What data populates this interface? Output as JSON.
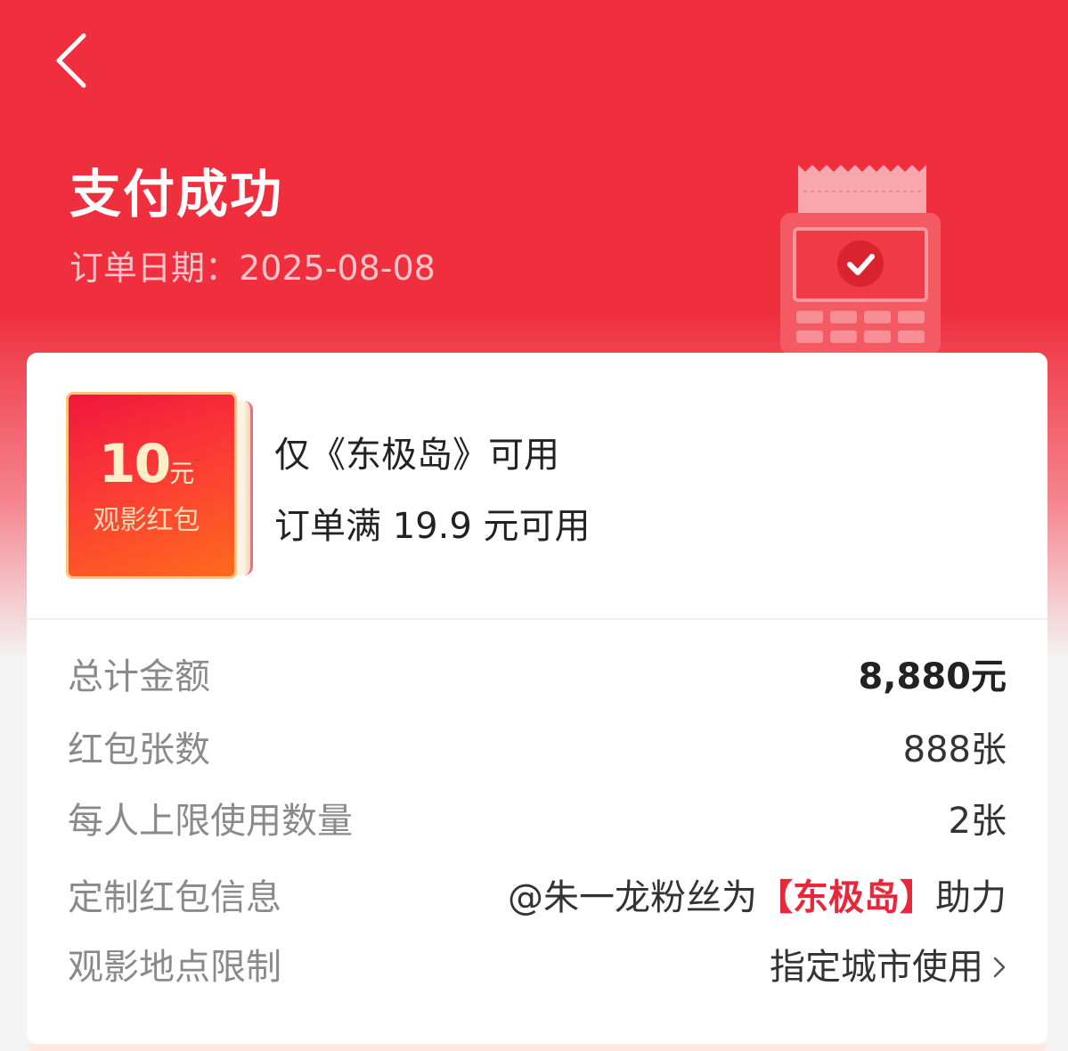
{
  "header": {
    "title": "支付成功",
    "order_date_label": "订单日期：",
    "order_date": "2025-08-08"
  },
  "coupon": {
    "amount": "10",
    "unit": "元",
    "name": "观影红包",
    "line1": "仅《东极岛》可用",
    "line2": "订单满 19.9 元可用"
  },
  "details": {
    "total_label": "总计金额",
    "total_value": "8,880元",
    "count_label": "红包张数",
    "count_value": "888张",
    "limit_label": "每人上限使用数量",
    "limit_value": "2张",
    "custom_label": "定制红包信息",
    "custom_prefix": "@朱一龙粉丝为",
    "custom_highlight": "【东极岛】",
    "custom_suffix": "助力",
    "location_label": "观影地点限制",
    "location_value": "指定城市使用"
  },
  "icons": {
    "back": "chevron-left-icon",
    "pos": "pos-terminal-icon",
    "arrow": "chevron-right-icon"
  },
  "colors": {
    "brand_red": "#ef2f3e",
    "highlight_red": "#e8283a"
  }
}
